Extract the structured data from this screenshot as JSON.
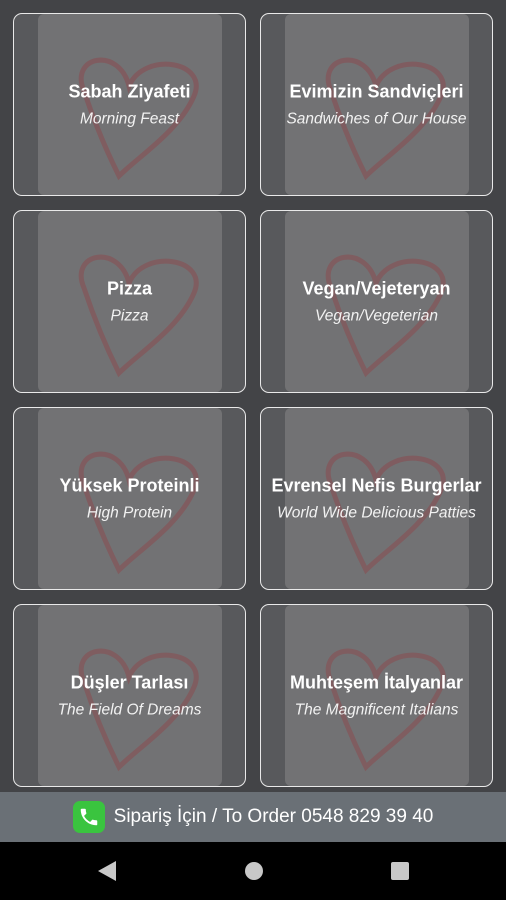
{
  "categories": [
    {
      "title": "Sabah Ziyafeti",
      "subtitle": "Morning Feast"
    },
    {
      "title": "Evimizin Sandviçleri",
      "subtitle": "Sandwiches of Our House"
    },
    {
      "title": "Pizza",
      "subtitle": "Pizza"
    },
    {
      "title": "Vegan/Vejeteryan",
      "subtitle": "Vegan/Vegeterian"
    },
    {
      "title": "Yüksek Proteinli",
      "subtitle": "High Protein"
    },
    {
      "title": "Evrensel Nefis Burgerlar",
      "subtitle": "World Wide Delicious Patties"
    },
    {
      "title": "Düşler Tarlası",
      "subtitle": "The Field Of Dreams"
    },
    {
      "title": "Muhteşem İtalyanlar",
      "subtitle": "The Magnificent Italians"
    }
  ],
  "order_bar": {
    "text": "Sipariş İçin / To Order 0548 829 39 40",
    "icon": "phone-icon"
  },
  "nav": {
    "back": "back-icon",
    "home": "home-icon",
    "recents": "recents-icon"
  },
  "colors": {
    "background": "#434447",
    "card_border": "#e9e9e9",
    "order_bar": "#6a7076",
    "phone_green": "#3ac43f",
    "heart": "#8a4c50"
  }
}
